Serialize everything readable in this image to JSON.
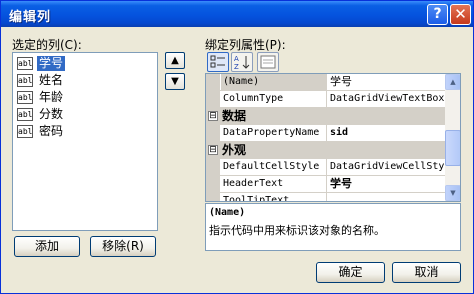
{
  "window": {
    "title": "编辑列",
    "help_glyph": "?",
    "close_glyph": "✕"
  },
  "left": {
    "label": "选定的列(C):",
    "items": [
      {
        "icon": "abl",
        "label": "学号",
        "selected": true
      },
      {
        "icon": "abl",
        "label": "姓名",
        "selected": false
      },
      {
        "icon": "abl",
        "label": "年龄",
        "selected": false
      },
      {
        "icon": "abl",
        "label": "分数",
        "selected": false
      },
      {
        "icon": "abl",
        "label": "密码",
        "selected": false
      }
    ],
    "up_glyph": "▲",
    "down_glyph": "▼",
    "add_label": "添加",
    "remove_label": "移除(R)"
  },
  "right": {
    "label": "绑定列属性(P):",
    "toolbar": {
      "categorized_icon": "categorized-icon",
      "alphabetical_icon": "alphabetical-icon",
      "pages_icon": "property-pages-icon"
    },
    "grid": {
      "rows": [
        {
          "kind": "prop",
          "name": "(Name)",
          "value": "学号",
          "selected": true
        },
        {
          "kind": "prop",
          "name": "ColumnType",
          "value": "DataGridViewTextBoxColumn"
        },
        {
          "kind": "cat",
          "name": "数据",
          "toggle": "⊟"
        },
        {
          "kind": "prop",
          "name": "DataPropertyName",
          "value": "sid",
          "bold": true
        },
        {
          "kind": "cat",
          "name": "外观",
          "toggle": "⊟"
        },
        {
          "kind": "prop",
          "name": "DefaultCellStyle",
          "value": "DataGridViewCellStyle"
        },
        {
          "kind": "prop",
          "name": "HeaderText",
          "value": "学号",
          "bold": true
        },
        {
          "kind": "prop",
          "name": "ToolTipText",
          "value": ""
        }
      ]
    },
    "description": {
      "name": "(Name)",
      "text": "指示代码中用来标识该对象的名称。"
    }
  },
  "footer": {
    "ok_label": "确定",
    "cancel_label": "取消"
  }
}
